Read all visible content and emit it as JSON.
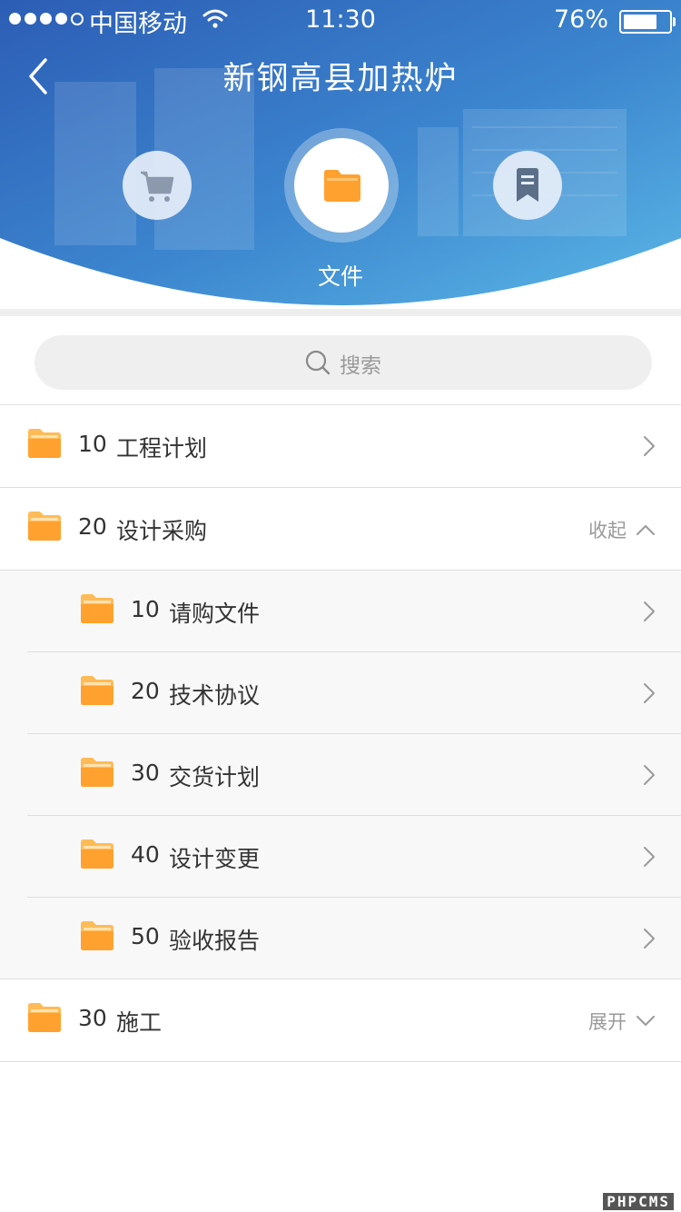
{
  "status_bar": {
    "carrier": "中国移动",
    "time": "11:30",
    "battery": "76%",
    "battery_level": 0.76
  },
  "header": {
    "title": "新钢高县加热炉",
    "tabs": [
      {
        "icon": "cart-icon"
      },
      {
        "icon": "folder-icon",
        "label": "文件",
        "active": true
      },
      {
        "icon": "bookmark-icon"
      }
    ]
  },
  "search": {
    "placeholder": "搜索"
  },
  "folders": [
    {
      "code": "10",
      "name": "工程计划"
    },
    {
      "code": "20",
      "name": "设计采购",
      "toggle": "收起",
      "children": [
        {
          "code": "10",
          "name": "请购文件"
        },
        {
          "code": "20",
          "name": "技术协议"
        },
        {
          "code": "30",
          "name": "交货计划"
        },
        {
          "code": "40",
          "name": "设计变更"
        },
        {
          "code": "50",
          "name": "验收报告"
        }
      ]
    },
    {
      "code": "30",
      "name": "施工",
      "toggle": "展开"
    }
  ],
  "watermark": "PHPCMS",
  "colors": {
    "header_top": "#2f64b8",
    "header_bottom": "#4aa6de",
    "folder_orange": "#ffa12e",
    "chevron": "#9a9a9a"
  }
}
